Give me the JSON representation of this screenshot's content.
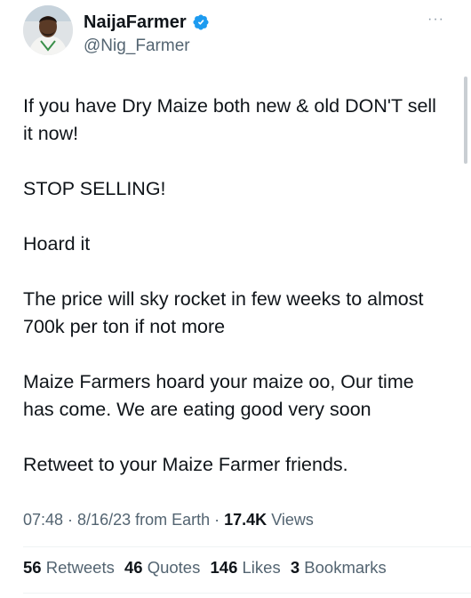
{
  "author": {
    "display_name": "NaijaFarmer",
    "handle": "@Nig_Farmer",
    "verified_icon": "verified-badge-icon",
    "avatar_icon": "avatar-photo"
  },
  "menu": {
    "more_label": "···"
  },
  "tweet": {
    "paragraphs": [
      "If you have Dry Maize both new & old DON'T sell it now!",
      "STOP SELLING!",
      "Hoard it",
      "The price will sky rocket in few weeks to almost 700k per ton if not more",
      "Maize Farmers hoard your maize oo, Our time has come. We are eating good very soon",
      "Retweet to your Maize Farmer friends."
    ]
  },
  "meta": {
    "time": "07:48",
    "sep1": " · ",
    "date": "8/16/23",
    "source": " from Earth",
    "sep2": " · ",
    "views_count": "17.4K",
    "views_label": " Views"
  },
  "stats": {
    "retweets_count": "56",
    "retweets_label": " Retweets",
    "quotes_count": "46",
    "quotes_label": " Quotes",
    "likes_count": "146",
    "likes_label": " Likes",
    "bookmarks_count": "3",
    "bookmarks_label": " Bookmarks"
  },
  "colors": {
    "text_primary": "#0f1419",
    "text_secondary": "#536471",
    "verified_blue": "#1d9bf0",
    "divider": "#eff3f4"
  }
}
